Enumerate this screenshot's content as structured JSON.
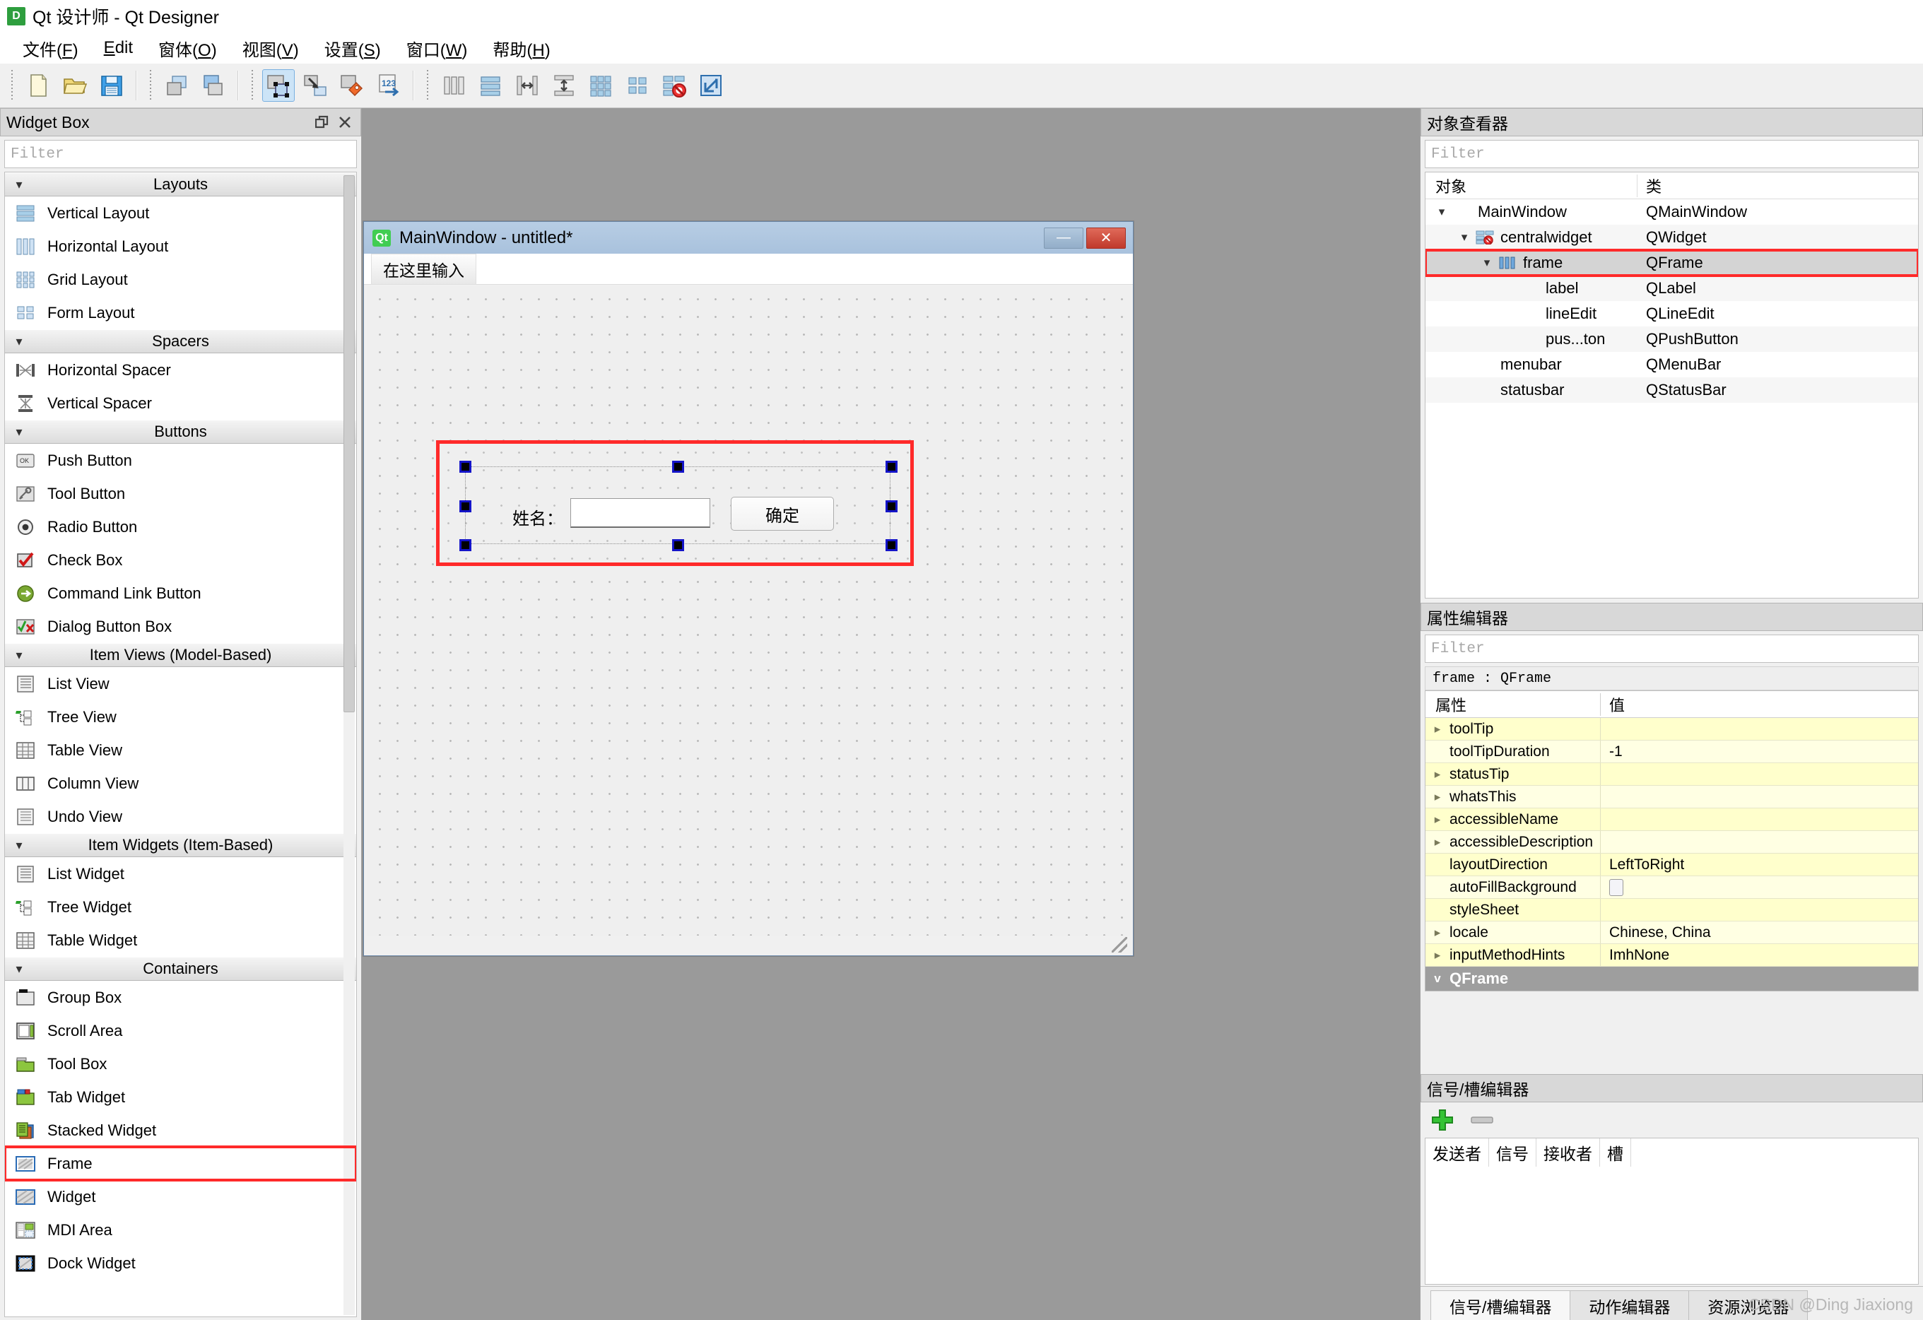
{
  "window": {
    "title": "Qt 设计师 - Qt Designer",
    "app_icon": "D"
  },
  "menubar": {
    "items": [
      {
        "label": "文件(F)",
        "name": "menu-file"
      },
      {
        "label": "Edit",
        "name": "menu-edit"
      },
      {
        "label": "窗体(O)",
        "name": "menu-form"
      },
      {
        "label": "视图(V)",
        "name": "menu-view"
      },
      {
        "label": "设置(S)",
        "name": "menu-settings"
      },
      {
        "label": "窗口(W)",
        "name": "menu-window"
      },
      {
        "label": "帮助(H)",
        "name": "menu-help"
      }
    ]
  },
  "toolbar": {
    "groups": [
      {
        "buttons": [
          "new-file-icon",
          "open-folder-icon",
          "save-icon"
        ]
      },
      {
        "buttons": [
          "copy-windows-icon",
          "paste-windows-icon"
        ]
      },
      {
        "buttons": [
          "edit-widgets-icon",
          "edit-signals-slots-icon",
          "edit-buddies-icon",
          "edit-tab-order-icon"
        ]
      },
      {
        "buttons": [
          "layout-horizontal-icon",
          "layout-vertical-icon",
          "layout-split-horizontal-icon",
          "layout-split-vertical-icon",
          "layout-grid-icon",
          "layout-form-icon",
          "break-layout-icon",
          "adjust-size-icon"
        ]
      }
    ],
    "active_button": "edit-widgets-icon"
  },
  "widget_box": {
    "title": "Widget Box",
    "filter_placeholder": "Filter",
    "groups": [
      {
        "name": "Layouts",
        "items": [
          {
            "label": "Vertical Layout",
            "icon": "vertical-layout-icon"
          },
          {
            "label": "Horizontal Layout",
            "icon": "horizontal-layout-icon"
          },
          {
            "label": "Grid Layout",
            "icon": "grid-layout-icon"
          },
          {
            "label": "Form Layout",
            "icon": "form-layout-icon"
          }
        ]
      },
      {
        "name": "Spacers",
        "items": [
          {
            "label": "Horizontal Spacer",
            "icon": "horizontal-spacer-icon"
          },
          {
            "label": "Vertical Spacer",
            "icon": "vertical-spacer-icon"
          }
        ]
      },
      {
        "name": "Buttons",
        "items": [
          {
            "label": "Push Button",
            "icon": "push-button-icon"
          },
          {
            "label": "Tool Button",
            "icon": "tool-button-icon"
          },
          {
            "label": "Radio Button",
            "icon": "radio-button-icon"
          },
          {
            "label": "Check Box",
            "icon": "check-box-icon"
          },
          {
            "label": "Command Link Button",
            "icon": "command-link-button-icon"
          },
          {
            "label": "Dialog Button Box",
            "icon": "dialog-button-box-icon"
          }
        ]
      },
      {
        "name": "Item Views (Model-Based)",
        "items": [
          {
            "label": "List View",
            "icon": "list-view-icon"
          },
          {
            "label": "Tree View",
            "icon": "tree-view-icon"
          },
          {
            "label": "Table View",
            "icon": "table-view-icon"
          },
          {
            "label": "Column View",
            "icon": "column-view-icon"
          },
          {
            "label": "Undo View",
            "icon": "undo-view-icon"
          }
        ]
      },
      {
        "name": "Item Widgets (Item-Based)",
        "items": [
          {
            "label": "List Widget",
            "icon": "list-widget-icon"
          },
          {
            "label": "Tree Widget",
            "icon": "tree-widget-icon"
          },
          {
            "label": "Table Widget",
            "icon": "table-widget-icon"
          }
        ]
      },
      {
        "name": "Containers",
        "items": [
          {
            "label": "Group Box",
            "icon": "group-box-icon"
          },
          {
            "label": "Scroll Area",
            "icon": "scroll-area-icon"
          },
          {
            "label": "Tool Box",
            "icon": "tool-box-icon"
          },
          {
            "label": "Tab Widget",
            "icon": "tab-widget-icon"
          },
          {
            "label": "Stacked Widget",
            "icon": "stacked-widget-icon"
          },
          {
            "label": "Frame",
            "icon": "frame-icon",
            "highlighted": true
          },
          {
            "label": "Widget",
            "icon": "widget-icon"
          },
          {
            "label": "MDI Area",
            "icon": "mdi-area-icon"
          },
          {
            "label": "Dock Widget",
            "icon": "dock-widget-icon"
          }
        ]
      }
    ]
  },
  "form_window": {
    "title": "MainWindow - untitled*",
    "qt_badge": "Qt",
    "menu_placeholder": "在这里输入",
    "minimize_label": "—",
    "close_label": "✕",
    "frame_contents": {
      "label": "姓名：",
      "line_edit_value": "",
      "button_label": "确定"
    }
  },
  "object_inspector": {
    "title": "对象查看器",
    "filter_placeholder": "Filter",
    "columns": [
      "对象",
      "类"
    ],
    "rows": [
      {
        "name": "MainWindow",
        "class": "QMainWindow",
        "indent": 0,
        "chevron": "v",
        "icon": ""
      },
      {
        "name": "centralwidget",
        "class": "QWidget",
        "indent": 1,
        "chevron": "v",
        "icon": "broken-layout-icon"
      },
      {
        "name": "frame",
        "class": "QFrame",
        "indent": 2,
        "chevron": "v",
        "icon": "horizontal-layout-icon",
        "selected": true,
        "highlighted": true
      },
      {
        "name": "label",
        "class": "QLabel",
        "indent": 3,
        "chevron": "",
        "icon": ""
      },
      {
        "name": "lineEdit",
        "class": "QLineEdit",
        "indent": 3,
        "chevron": "",
        "icon": ""
      },
      {
        "name": "pus...ton",
        "class": "QPushButton",
        "indent": 3,
        "chevron": "",
        "icon": ""
      },
      {
        "name": "menubar",
        "class": "QMenuBar",
        "indent": 1,
        "chevron": "",
        "icon": ""
      },
      {
        "name": "statusbar",
        "class": "QStatusBar",
        "indent": 1,
        "chevron": "",
        "icon": ""
      }
    ]
  },
  "property_editor": {
    "title": "属性编辑器",
    "filter_placeholder": "Filter",
    "subject": "frame : QFrame",
    "columns": [
      "属性",
      "值"
    ],
    "rows": [
      {
        "property": "toolTip",
        "value": "",
        "expandable": true
      },
      {
        "property": "toolTipDuration",
        "value": "-1",
        "expandable": false
      },
      {
        "property": "statusTip",
        "value": "",
        "expandable": true
      },
      {
        "property": "whatsThis",
        "value": "",
        "expandable": true
      },
      {
        "property": "accessibleName",
        "value": "",
        "expandable": true
      },
      {
        "property": "accessibleDescription",
        "value": "",
        "expandable": true
      },
      {
        "property": "layoutDirection",
        "value": "LeftToRight",
        "expandable": false
      },
      {
        "property": "autoFillBackground",
        "value": "",
        "expandable": false,
        "checkbox": true
      },
      {
        "property": "styleSheet",
        "value": "",
        "expandable": false
      },
      {
        "property": "locale",
        "value": "Chinese, China",
        "expandable": true
      },
      {
        "property": "inputMethodHints",
        "value": "ImhNone",
        "expandable": true
      }
    ],
    "group_row": {
      "label": "QFrame",
      "chevron": "v"
    }
  },
  "signal_slot_editor": {
    "title": "信号/槽编辑器",
    "add_icon": "plus-icon",
    "remove_icon": "minus-icon",
    "columns": [
      "发送者",
      "信号",
      "接收者",
      "槽"
    ]
  },
  "bottom_tabs": [
    {
      "label": "信号/槽编辑器",
      "active": true
    },
    {
      "label": "动作编辑器",
      "active": false
    },
    {
      "label": "资源浏览器",
      "active": false
    }
  ],
  "watermark": "CSDN @Ding Jiaxiong",
  "colors": {
    "annotation_red": "#ff2a2a",
    "selection_handle": "#1414c8",
    "property_yellow": "#ffffcc",
    "form_title": "#a9c2dd",
    "canvas_gray": "#9a9a9a"
  }
}
